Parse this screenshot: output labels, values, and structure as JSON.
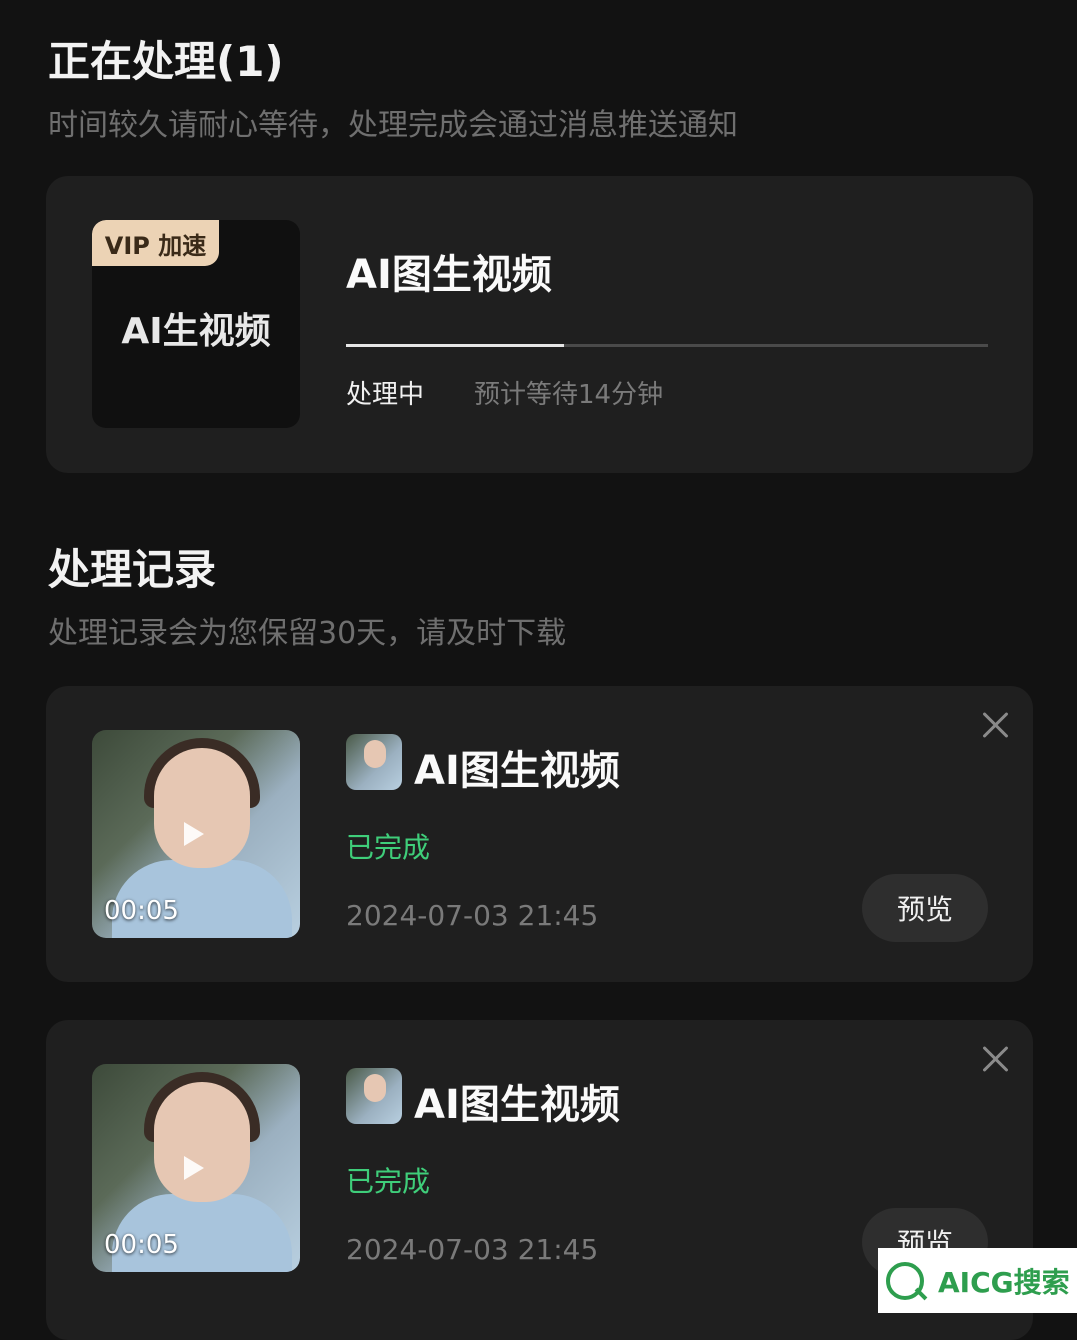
{
  "processing": {
    "title": "正在处理(1)",
    "subtitle": "时间较久请耐心等待，处理完成会通过消息推送通知",
    "item": {
      "badge": "VIP 加速",
      "thumb_text": "AI生视频",
      "title": "AI图生视频",
      "progress": 0.34,
      "status": "处理中",
      "eta": "预计等待14分钟"
    }
  },
  "records": {
    "title": "处理记录",
    "subtitle": "处理记录会为您保留30天，请及时下载",
    "items": [
      {
        "duration": "00:05",
        "title": "AI图生视频",
        "status": "已完成",
        "time": "2024-07-03 21:45",
        "preview_label": "预览"
      },
      {
        "duration": "00:05",
        "title": "AI图生视频",
        "status": "已完成",
        "time": "2024-07-03 21:45",
        "preview_label": "预览"
      }
    ]
  },
  "watermark": {
    "text": "AICG搜索"
  },
  "colors": {
    "background": "#121212",
    "card": "#1f1f1f",
    "success": "#3fce7a",
    "vip_badge": "#ecd3b5"
  }
}
